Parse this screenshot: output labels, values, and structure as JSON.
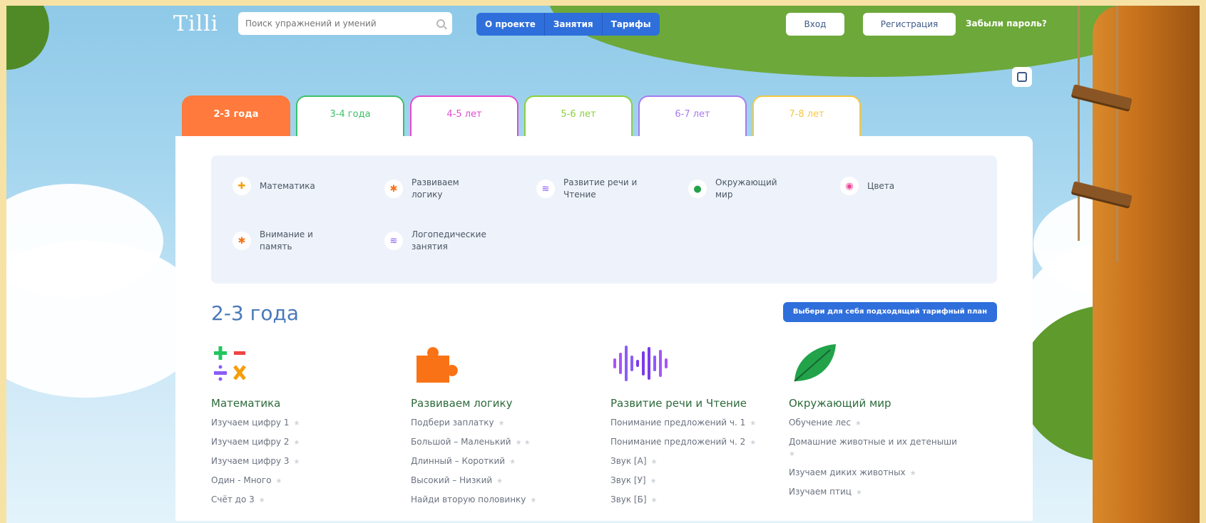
{
  "header": {
    "logo": "Tilli",
    "search_placeholder": "Поиск упражнений и умений",
    "nav": [
      "О проекте",
      "Занятия",
      "Тарифы"
    ],
    "login": "Вход",
    "register": "Регистрация",
    "forgot": "Забыли пароль?"
  },
  "tabs": [
    {
      "label": "2-3 года",
      "color": "#ff7a3c",
      "active": true
    },
    {
      "label": "3-4 года",
      "color": "#3fbf6a",
      "active": false
    },
    {
      "label": "4-5 лет",
      "color": "#e24bd0",
      "active": false
    },
    {
      "label": "5-6 лет",
      "color": "#8ad13a",
      "active": false
    },
    {
      "label": "6-7 лет",
      "color": "#a77af0",
      "active": false
    },
    {
      "label": "7-8 лет",
      "color": "#f5c842",
      "active": false
    }
  ],
  "categories": [
    {
      "label": "Математика",
      "icon": "math-icon"
    },
    {
      "label": "Развиваем логику",
      "icon": "puzzle-icon"
    },
    {
      "label": "Развитие речи и Чтение",
      "icon": "soundwave-icon"
    },
    {
      "label": "Окружающий мир",
      "icon": "leaf-icon"
    },
    {
      "label": "Цвета",
      "icon": "palette-icon"
    },
    {
      "label": "Внимание и память",
      "icon": "puzzle-icon"
    },
    {
      "label": "Логопедические занятия",
      "icon": "soundwave-icon"
    }
  ],
  "age_title": "2-3 года",
  "plan_button": "Выбери для себя подходящий тарифный план",
  "columns": [
    {
      "title": "Математика",
      "icon": "math-icon",
      "items": [
        {
          "label": "Изучаем цифру 1",
          "stars": 1
        },
        {
          "label": "Изучаем цифру 2",
          "stars": 1
        },
        {
          "label": "Изучаем цифру 3",
          "stars": 1
        },
        {
          "label": "Один - Много",
          "stars": 1
        },
        {
          "label": "Счёт до 3",
          "stars": 1
        }
      ]
    },
    {
      "title": "Развиваем логику",
      "icon": "puzzle-icon",
      "items": [
        {
          "label": "Подбери заплатку",
          "stars": 1
        },
        {
          "label": "Большой – Маленький",
          "stars": 2
        },
        {
          "label": "Длинный – Короткий",
          "stars": 1
        },
        {
          "label": "Высокий – Низкий",
          "stars": 1
        },
        {
          "label": "Найди вторую половинку",
          "stars": 1
        }
      ]
    },
    {
      "title": "Развитие речи и Чтение",
      "icon": "soundwave-icon",
      "items": [
        {
          "label": "Понимание предложений ч. 1",
          "stars": 1
        },
        {
          "label": "Понимание предложений ч. 2",
          "stars": 1
        },
        {
          "label": "Звук [А]",
          "stars": 1
        },
        {
          "label": "Звук [У]",
          "stars": 1
        },
        {
          "label": "Звук [Б]",
          "stars": 1
        }
      ]
    },
    {
      "title": "Окружающий мир",
      "icon": "leaf-icon",
      "items": [
        {
          "label": "Обучение лес",
          "stars": 1
        },
        {
          "label": "Домашние животные и их детеныши",
          "stars": 1
        },
        {
          "label": "Изучаем диких животных",
          "stars": 1
        },
        {
          "label": "Изучаем птиц",
          "stars": 1
        }
      ]
    }
  ]
}
